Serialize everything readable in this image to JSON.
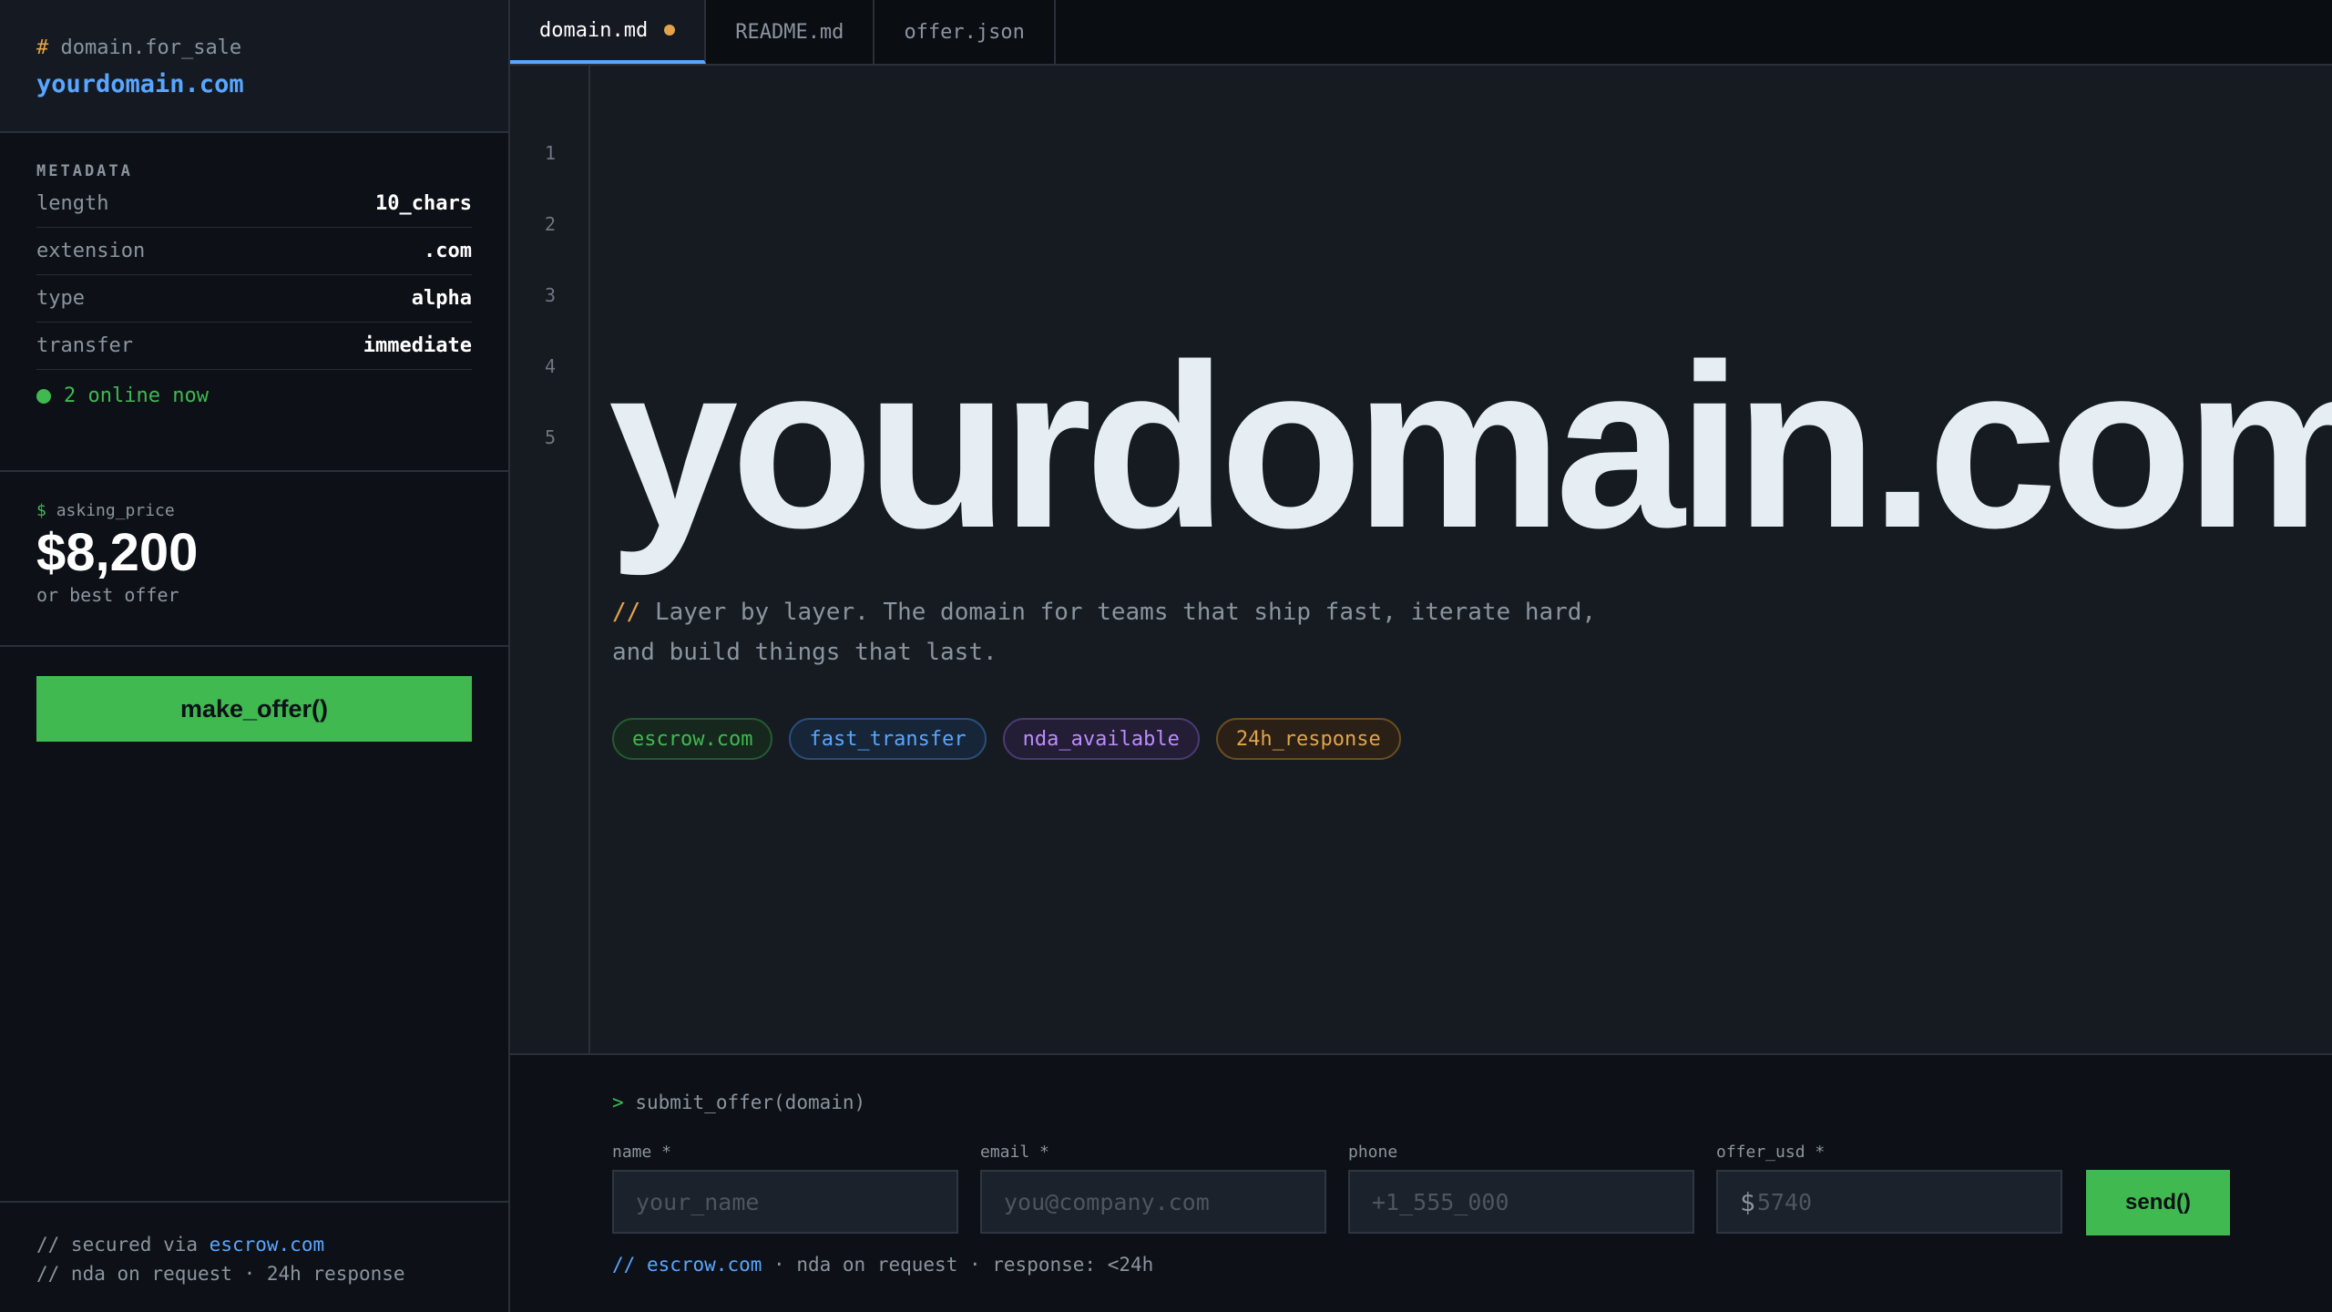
{
  "sidebar": {
    "path_prefix": "#",
    "path": "domain.for_sale",
    "domain": "yourdomain.com",
    "metadata_title": "METADATA",
    "metadata": [
      {
        "key": "length",
        "value": "10_chars"
      },
      {
        "key": "extension",
        "value": ".com"
      },
      {
        "key": "type",
        "value": "alpha"
      },
      {
        "key": "transfer",
        "value": "immediate"
      }
    ],
    "online": "2 online now",
    "price_prefix": "$",
    "price_label": "asking_price",
    "price": "$8,200",
    "price_note": "or best offer",
    "cta": "make_offer()",
    "footer_line1_prefix": "// secured via",
    "footer_line1_link": "escrow.com",
    "footer_line2": "// nda on request · 24h response"
  },
  "tabs": [
    {
      "label": "domain.md",
      "modified": true
    },
    {
      "label": "README.md"
    },
    {
      "label": "offer.json"
    }
  ],
  "editor": {
    "line_numbers": [
      "1",
      "2",
      "3",
      "4",
      "5"
    ],
    "hero": "yourdomain.com",
    "comment_marker": "//",
    "description_line1": "Layer by layer. The domain for teams that ship fast, iterate hard,",
    "description_line2": "and build things that last.",
    "tags": [
      "escrow.com",
      "fast_transfer",
      "nda_available",
      "24h_response"
    ]
  },
  "form": {
    "prompt_symbol": ">",
    "prompt": "submit_offer(domain)",
    "fields": [
      {
        "label": "name *",
        "placeholder": "your_name"
      },
      {
        "label": "email *",
        "placeholder": "you@company.com"
      },
      {
        "label": "phone",
        "placeholder": "+1_555_000"
      },
      {
        "label": "offer_usd *",
        "currency": "$",
        "placeholder": "5740"
      }
    ],
    "submit": "send()",
    "footer_prefix": "//",
    "footer_link": "escrow.com",
    "footer_rest": "· nda on request · response: <24h"
  },
  "colors": {
    "accent_green": "#3fb950",
    "accent_blue": "#58a6ff",
    "accent_orange": "#e3a34a",
    "accent_purple": "#bc8cff",
    "background": "#0d1117"
  }
}
